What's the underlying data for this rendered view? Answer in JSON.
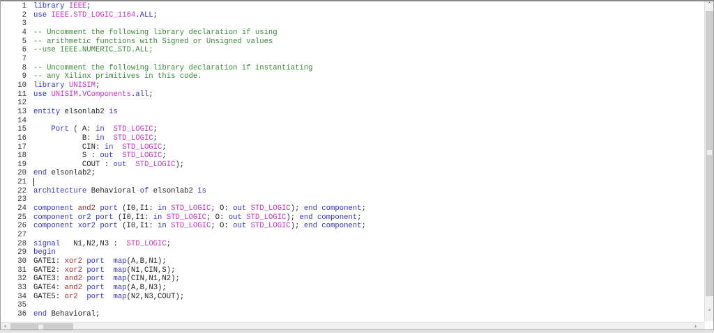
{
  "editor": {
    "scroll_left_icon": "‹",
    "scroll_right_icon": "›",
    "scroll_up_icon": "˄",
    "scroll_down_icon": "˅",
    "caret_line": 21,
    "lines": [
      [
        [
          "library ",
          "kw"
        ],
        [
          "IEEE",
          "ty"
        ],
        [
          ";",
          "pl"
        ]
      ],
      [
        [
          "use ",
          "kw"
        ],
        [
          "IEEE.STD_LOGIC_1164",
          "ty"
        ],
        [
          ".",
          "pl"
        ],
        [
          "ALL",
          "kw"
        ],
        [
          ";",
          "pl"
        ]
      ],
      [],
      [
        [
          "-- Uncomment the following library declaration if using",
          "cm"
        ]
      ],
      [
        [
          "-- arithmetic functions with Signed or Unsigned values",
          "cm"
        ]
      ],
      [
        [
          "--use IEEE.NUMERIC_STD.ALL;",
          "cm"
        ]
      ],
      [],
      [
        [
          "-- Uncomment the following library declaration if instantiating",
          "cm"
        ]
      ],
      [
        [
          "-- any Xilinx primitives in this code.",
          "cm"
        ]
      ],
      [
        [
          "library ",
          "kw"
        ],
        [
          "UNISIM",
          "ty"
        ],
        [
          ";",
          "pl"
        ]
      ],
      [
        [
          "use ",
          "kw"
        ],
        [
          "UNISIM",
          "ty"
        ],
        [
          ".",
          "pl"
        ],
        [
          "VComponents",
          "ty"
        ],
        [
          ".",
          "pl"
        ],
        [
          "all",
          "kw"
        ],
        [
          ";",
          "pl"
        ]
      ],
      [],
      [
        [
          "entity ",
          "kw"
        ],
        [
          "elsonlab2 ",
          "pl"
        ],
        [
          "is",
          "kw"
        ]
      ],
      [],
      [
        [
          "    Port ",
          "kw"
        ],
        [
          "( A: ",
          "pl"
        ],
        [
          "in",
          "kw"
        ],
        [
          "  ",
          "pl"
        ],
        [
          "STD_LOGIC",
          "ty"
        ],
        [
          ";",
          "pl"
        ]
      ],
      [
        [
          "           B: ",
          "pl"
        ],
        [
          "in",
          "kw"
        ],
        [
          "  ",
          "pl"
        ],
        [
          "STD_LOGIC",
          "ty"
        ],
        [
          ";",
          "pl"
        ]
      ],
      [
        [
          "           CIN: ",
          "pl"
        ],
        [
          "in",
          "kw"
        ],
        [
          "  ",
          "pl"
        ],
        [
          "STD_LOGIC",
          "ty"
        ],
        [
          ";",
          "pl"
        ]
      ],
      [
        [
          "           S : ",
          "pl"
        ],
        [
          "out",
          "kw"
        ],
        [
          "  ",
          "pl"
        ],
        [
          "STD_LOGIC",
          "ty"
        ],
        [
          ";",
          "pl"
        ]
      ],
      [
        [
          "           COUT : ",
          "pl"
        ],
        [
          "out",
          "kw"
        ],
        [
          "  ",
          "pl"
        ],
        [
          "STD_LOGIC",
          "ty"
        ],
        [
          ");",
          "pl"
        ]
      ],
      [
        [
          "end ",
          "kw"
        ],
        [
          "elsonlab2;",
          "pl"
        ]
      ],
      [],
      [
        [
          "architecture ",
          "kw"
        ],
        [
          "Behavioral ",
          "pl"
        ],
        [
          "of ",
          "kw"
        ],
        [
          "elsonlab2 ",
          "pl"
        ],
        [
          "is",
          "kw"
        ]
      ],
      [],
      [
        [
          "component ",
          "kw"
        ],
        [
          "and2 ",
          "nm"
        ],
        [
          "port ",
          "kw"
        ],
        [
          "(I0,I1: ",
          "pl"
        ],
        [
          "in ",
          "kw"
        ],
        [
          "STD_LOGIC",
          "ty"
        ],
        [
          "; O: ",
          "pl"
        ],
        [
          "out ",
          "kw"
        ],
        [
          "STD_LOGIC",
          "ty"
        ],
        [
          "); ",
          "pl"
        ],
        [
          "end component",
          "kw"
        ],
        [
          ";",
          "pl"
        ]
      ],
      [
        [
          "component ",
          "kw"
        ],
        [
          "or2 ",
          "kw"
        ],
        [
          "port ",
          "kw"
        ],
        [
          "(I0,I1: ",
          "pl"
        ],
        [
          "in ",
          "kw"
        ],
        [
          "STD_LOGIC",
          "ty"
        ],
        [
          "; O: ",
          "pl"
        ],
        [
          "out ",
          "kw"
        ],
        [
          "STD_LOGIC",
          "ty"
        ],
        [
          "); ",
          "pl"
        ],
        [
          "end component",
          "kw"
        ],
        [
          ";",
          "pl"
        ]
      ],
      [
        [
          "component ",
          "kw"
        ],
        [
          "xor2 ",
          "kw"
        ],
        [
          "port ",
          "kw"
        ],
        [
          "(I0,I1: ",
          "pl"
        ],
        [
          "in ",
          "kw"
        ],
        [
          "STD_LOGIC",
          "ty"
        ],
        [
          "; O: ",
          "pl"
        ],
        [
          "out ",
          "kw"
        ],
        [
          "STD_LOGIC",
          "ty"
        ],
        [
          "); ",
          "pl"
        ],
        [
          "end component",
          "kw"
        ],
        [
          ";",
          "pl"
        ]
      ],
      [],
      [
        [
          "signal ",
          "kw"
        ],
        [
          "  N1,N2,N3 :  ",
          "pl"
        ],
        [
          "STD_LOGIC",
          "ty"
        ],
        [
          ";",
          "pl"
        ]
      ],
      [
        [
          "begin",
          "kw"
        ]
      ],
      [
        [
          "GATE1: ",
          "pl"
        ],
        [
          "xor2 ",
          "nm"
        ],
        [
          "port  ",
          "kw"
        ],
        [
          "map",
          "kw"
        ],
        [
          "(A,B,N1);",
          "pl"
        ]
      ],
      [
        [
          "GATE2: ",
          "pl"
        ],
        [
          "xor2 ",
          "nm"
        ],
        [
          "port  ",
          "kw"
        ],
        [
          "map",
          "kw"
        ],
        [
          "(N1,CIN,S);",
          "pl"
        ]
      ],
      [
        [
          "GATE3: ",
          "pl"
        ],
        [
          "and2 ",
          "nm"
        ],
        [
          "port  ",
          "kw"
        ],
        [
          "map",
          "kw"
        ],
        [
          "(CIN,N1,N2);",
          "pl"
        ]
      ],
      [
        [
          "GATE4: ",
          "pl"
        ],
        [
          "and2 ",
          "nm"
        ],
        [
          "port  ",
          "kw"
        ],
        [
          "map",
          "kw"
        ],
        [
          "(A,B,N3);",
          "pl"
        ]
      ],
      [
        [
          "GATE5: ",
          "pl"
        ],
        [
          "or2  ",
          "nm"
        ],
        [
          "port  ",
          "kw"
        ],
        [
          "map",
          "kw"
        ],
        [
          "(N2,N3,COUT);",
          "pl"
        ]
      ],
      [],
      [
        [
          "end ",
          "kw"
        ],
        [
          "Behavioral;",
          "pl"
        ]
      ]
    ]
  },
  "colors": {
    "keyword": "#3535c8",
    "type": "#c832c8",
    "comment": "#3a8a3a",
    "component": "#a03030"
  }
}
